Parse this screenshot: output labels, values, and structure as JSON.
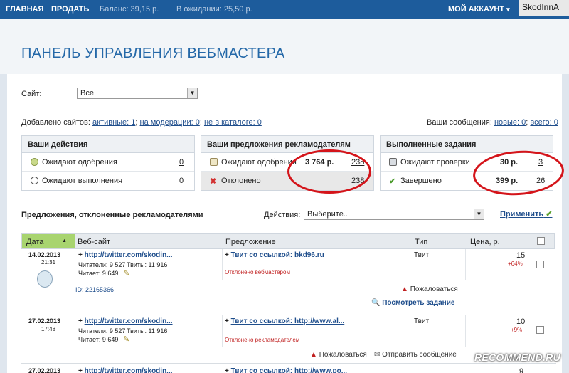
{
  "topbar": {
    "home": "ГЛАВНАЯ",
    "sell": "ПРОДАТЬ",
    "balance": "Баланс: 39,15 р.",
    "pending": "В ожидании: 25,50 р.",
    "account": "МОЙ АККАУНТ",
    "account_caret": "▾",
    "watermark": "SkodInnA"
  },
  "page_title": "ПАНЕЛЬ УПРАВЛЕНИЯ ВЕБМАСТЕРА",
  "site_filter": {
    "label": "Сайт:",
    "value": "Все"
  },
  "sites_stats": {
    "prefix": "Добавлено сайтов:",
    "active": "активные: 1",
    "moderation": "на модерации: 0",
    "not_in_catalog": "не в каталоге: 0",
    "sep1": ";",
    "sep2": ";"
  },
  "messages": {
    "prefix": "Ваши сообщения:",
    "new": "новые: 0",
    "all": "всего: 0",
    "sep": ";"
  },
  "actions_box": {
    "title": "Ваши действия",
    "rows": [
      {
        "label": "Ожидают одобрения",
        "count": "0"
      },
      {
        "label": "Ожидают выполнения",
        "count": "0"
      }
    ]
  },
  "offers_box": {
    "title": "Ваши предложения рекламодателям",
    "rows": [
      {
        "label": "Ожидают одобрения",
        "amount": "3 764 р.",
        "count": "238"
      },
      {
        "label": "Отклонено",
        "amount": "",
        "count": "238"
      }
    ]
  },
  "done_box": {
    "title": "Выполненные задания",
    "rows": [
      {
        "label": "Ожидают проверки",
        "amount": "30 р.",
        "count": "3"
      },
      {
        "label": "Завершено",
        "amount": "399 р.",
        "count": "26"
      }
    ]
  },
  "rejected_section": {
    "title": "Предложения, отклоненные рекламодателями",
    "actions_label": "Действия:",
    "actions_value": "Выберите...",
    "apply": "Применить",
    "apply_icon": "✔"
  },
  "table": {
    "headers": [
      "Дата",
      "Веб-сайт",
      "Предложение",
      "Тип",
      "Цена, р.",
      ""
    ],
    "sort_icon": "▲",
    "rows": [
      {
        "date": "14.02.2013",
        "time": "21:31",
        "site": "http://twitter.com/skodin...",
        "readers": "Читатели: 9 527",
        "tweets": "Твиты: 11 916",
        "reads": "Читает: 9 649",
        "offer": "Твит со ссылкой: bkd96.ru",
        "status": "Отклонено вебмастером",
        "type": "Твит",
        "price": "15",
        "delta": "+64%",
        "id": "ID: 22165366",
        "complain": "Пожаловаться",
        "view": "Посмотреть задание"
      },
      {
        "date": "27.02.2013",
        "time": "17:48",
        "site": "http://twitter.com/skodin...",
        "readers": "Читатели: 9 527",
        "tweets": "Твиты: 11 916",
        "reads": "Читает: 9 649",
        "offer": "Твит со ссылкой: http://www.al...",
        "status": "Отклонено рекламодателем",
        "type": "Твит",
        "price": "10",
        "delta": "+9%",
        "complain": "Пожаловаться",
        "send": "Отправить сообщение"
      },
      {
        "date": "27.02.2013",
        "site": "http://twitter.com/skodin...",
        "offer": "Твит со ссылкой: http://www.po...",
        "price": "9"
      }
    ]
  },
  "plus": "+",
  "recommend": "RECOMMEND.RU"
}
